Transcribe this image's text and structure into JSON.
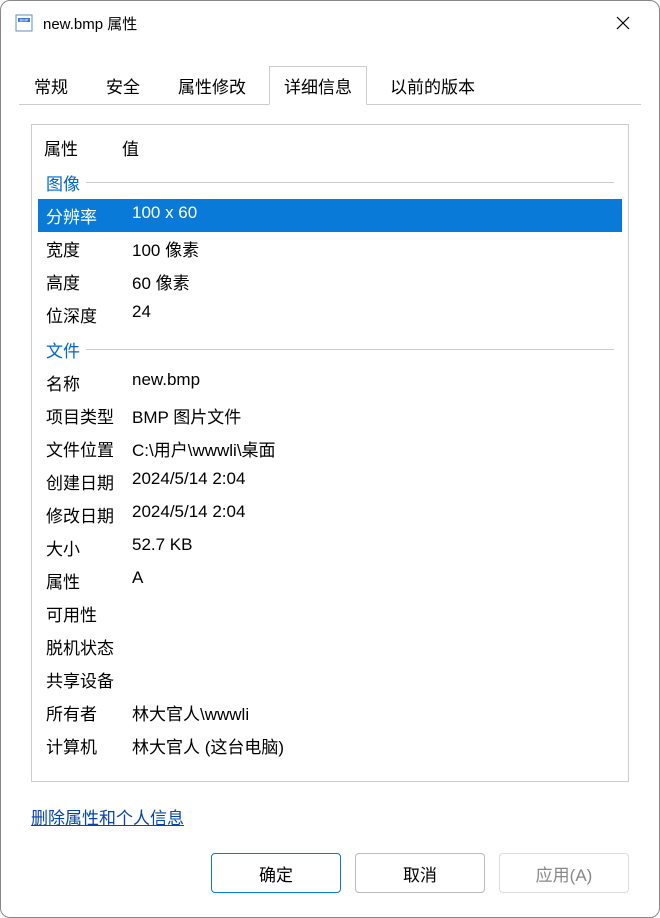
{
  "window": {
    "title": "new.bmp 属性"
  },
  "tabs": {
    "general": "常规",
    "security": "安全",
    "attribute_modify": "属性修改",
    "details": "详细信息",
    "previous_versions": "以前的版本"
  },
  "header": {
    "property": "属性",
    "value": "值"
  },
  "sections": {
    "image": "图像",
    "file": "文件"
  },
  "props": {
    "resolution": {
      "label": "分辨率",
      "value": "100 x 60"
    },
    "width": {
      "label": "宽度",
      "value": "100 像素"
    },
    "height": {
      "label": "高度",
      "value": "60 像素"
    },
    "bit_depth": {
      "label": "位深度",
      "value": "24"
    },
    "name": {
      "label": "名称",
      "value": "new.bmp"
    },
    "item_type": {
      "label": "项目类型",
      "value": "BMP 图片文件"
    },
    "file_location": {
      "label": "文件位置",
      "value": "C:\\用户\\wwwli\\桌面"
    },
    "created": {
      "label": "创建日期",
      "value": "2024/5/14 2:04"
    },
    "modified": {
      "label": "修改日期",
      "value": "2024/5/14 2:04"
    },
    "size": {
      "label": "大小",
      "value": "52.7 KB"
    },
    "attributes": {
      "label": "属性",
      "value": "A"
    },
    "availability": {
      "label": "可用性",
      "value": ""
    },
    "offline_status": {
      "label": "脱机状态",
      "value": ""
    },
    "shared_device": {
      "label": "共享设备",
      "value": ""
    },
    "owner": {
      "label": "所有者",
      "value": "林大官人\\wwwli"
    },
    "computer": {
      "label": "计算机",
      "value": "林大官人 (这台电脑)"
    }
  },
  "link": {
    "remove": "删除属性和个人信息"
  },
  "buttons": {
    "ok": "确定",
    "cancel": "取消",
    "apply": "应用(A)"
  }
}
